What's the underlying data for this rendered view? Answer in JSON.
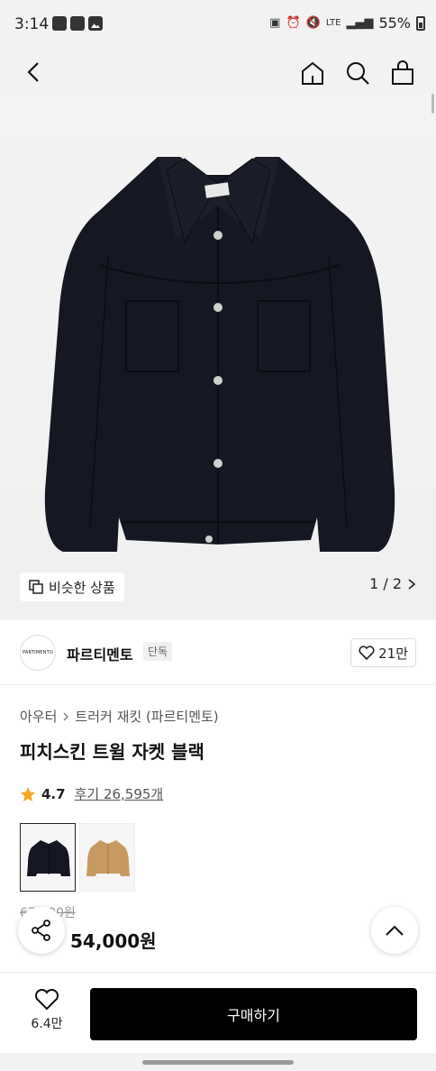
{
  "status_bar": {
    "time": "3:14",
    "network": "LTE",
    "battery": "55%"
  },
  "nav": {
    "back_icon": "chevron-left-icon",
    "icons": [
      "home-icon",
      "search-icon",
      "bag-icon"
    ]
  },
  "gallery": {
    "similar_label": "비슷한 상품",
    "pager": "1 / 2"
  },
  "brand": {
    "logo_text": "PARTIMENTO",
    "name": "파르티멘토",
    "badge": "단독",
    "likes": "21만"
  },
  "product": {
    "breadcrumb_1": "아우터",
    "breadcrumb_2": "트러커 재킷 (파르티멘토)",
    "title": "피치스킨 트윌 자켓 블랙",
    "rating": "4.7",
    "reviews": "후기 26,595개",
    "thumbnails": [
      "black",
      "tan"
    ],
    "original_price": "67,500원",
    "sale_price": "54,000원"
  },
  "bottom": {
    "wish_count": "6.4만",
    "buy_label": "구매하기"
  },
  "colors": {
    "accent": "#000000",
    "discount": "#e5372c",
    "star": "#f5a623"
  }
}
